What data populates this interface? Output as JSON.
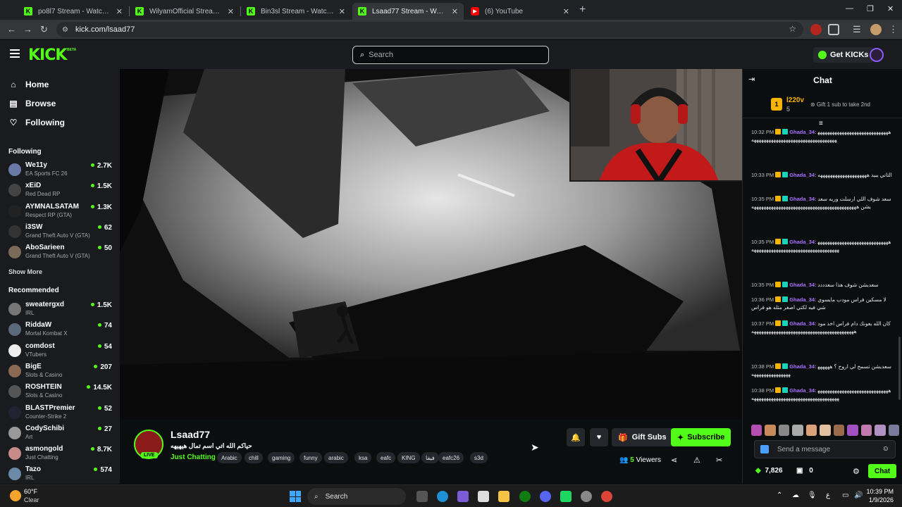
{
  "browser": {
    "tabs": [
      {
        "label": "po8l7 Stream - Watch Live on K",
        "icon": "kick",
        "active": false
      },
      {
        "label": "WilyamOfficial Stream - Watch",
        "icon": "kick",
        "active": false
      },
      {
        "label": "Bin3sl Stream - Watch Live on",
        "icon": "kick",
        "active": false
      },
      {
        "label": "Lsaad77 Stream - Watch Live o",
        "icon": "kick",
        "active": true
      },
      {
        "label": "(6) YouTube",
        "icon": "youtube",
        "active": false
      }
    ],
    "url": "kick.com/lsaad77",
    "extension_badge": "16"
  },
  "header": {
    "logo": "KICK",
    "logo_badge": "BETA",
    "search_placeholder": "Search",
    "get_kicks": "Get KICKs"
  },
  "sidebar": {
    "nav": [
      {
        "label": "Home",
        "icon": "home-icon"
      },
      {
        "label": "Browse",
        "icon": "browse-icon"
      },
      {
        "label": "Following",
        "icon": "heart-icon"
      }
    ],
    "following_heading": "Following",
    "following": [
      {
        "name": "We11y",
        "category": "EA Sports FC 26",
        "viewers": "2.7K",
        "color": "#6a7aa8"
      },
      {
        "name": "xEiD",
        "category": "Red Dead RP",
        "viewers": "1.5K",
        "color": "#444"
      },
      {
        "name": "AYMNALSATAM",
        "category": "Respect RP (GTA)",
        "viewers": "1.3K",
        "color": "#222"
      },
      {
        "name": "i3SW",
        "category": "Grand Theft Auto V (GTA)",
        "viewers": "62",
        "color": "#333"
      },
      {
        "name": "AboSarieen",
        "category": "Grand Theft Auto V (GTA)",
        "viewers": "50",
        "color": "#7a6a5a"
      }
    ],
    "show_more": "Show More",
    "recommended_heading": "Recommended",
    "recommended": [
      {
        "name": "sweatergxd",
        "category": "IRL",
        "viewers": "1.5K",
        "color": "#777"
      },
      {
        "name": "RiddaW",
        "category": "Mortal Kombat X",
        "viewers": "74",
        "color": "#5a6a7a"
      },
      {
        "name": "comdost",
        "category": "VTubers",
        "viewers": "54",
        "color": "#eee"
      },
      {
        "name": "BigE",
        "category": "Slots & Casino",
        "viewers": "207",
        "color": "#8a6a55"
      },
      {
        "name": "ROSHTEIN",
        "category": "Slots & Casino",
        "viewers": "14.5K",
        "color": "#555"
      },
      {
        "name": "BLASTPremier",
        "category": "Counter-Strike 2",
        "viewers": "52",
        "color": "#223"
      },
      {
        "name": "CodySchibi",
        "category": "Art",
        "viewers": "27",
        "color": "#999"
      },
      {
        "name": "asmongold",
        "category": "Just Chatting",
        "viewers": "8.7K",
        "color": "#c98a8a"
      },
      {
        "name": "Tazo",
        "category": "IRL",
        "viewers": "574",
        "color": "#6a8aa8"
      }
    ]
  },
  "stream": {
    "live_badge": "LIVE",
    "streamer": "Lsaad77",
    "title": "حياكم الله اتي اسم تمال هيهيهه",
    "category": "Just Chatting",
    "tags": [
      "Arabic",
      "chill",
      "gaming",
      "funny",
      "arabic",
      "ksa",
      "eafc",
      "KING",
      "فيفا",
      "eafc26",
      "s3d"
    ],
    "gift_subs": "Gift Subs",
    "subscribe": "Subscribe",
    "viewer_count": "5",
    "viewer_label": "Viewers"
  },
  "chat": {
    "title": "Chat",
    "leaderboard": {
      "rank": "1",
      "user": "l220v",
      "count": "5",
      "cta": "Gift 1 sub to take 2nd"
    },
    "messages": [
      {
        "time": "10:32 PM",
        "user": "Ghada_34",
        "text": "ههههههههههههههههههههههههههههههههههههههههههههههههههههههههههههههههه"
      },
      {
        "time": "10:33 PM",
        "user": "Ghada_34",
        "text": "الثاني يبيد ههههههههههههههههههههه"
      },
      {
        "time": "10:35 PM",
        "user": "Ghada_34",
        "text": "سعد شوف اللي ارسلت وريه سعديشن هههههههههههههههههههههههههههههههههههههههههههه"
      },
      {
        "time": "10:35 PM",
        "user": "Ghada_34",
        "text": "هههههههههههههههههههههههههههههههههههههههههههههههههههههههههههههههههه"
      },
      {
        "time": "10:35 PM",
        "user": "Ghada_34",
        "text": "سعديشن شوف هذا سعدددد"
      },
      {
        "time": "10:36 PM",
        "user": "Ghada_34",
        "text": "لا مسكين فراس مودب مايسوي شي فيه لكتي اصغر مثله هو فراس"
      },
      {
        "time": "10:37 PM",
        "user": "Ghada_34",
        "text": "كان الله بعونك دام فراس اخذ مود ههههههههههههههههههههههههههههههههههههههههههه"
      },
      {
        "time": "10:38 PM",
        "user": "Ghada_34",
        "text": "سعديشن تسمح لي اروح ؟ هههههههههههههههههههههه"
      },
      {
        "time": "10:38 PM",
        "user": "Ghada_34",
        "text": "هههههههههههههههههههههههههههههههههههههههههههههههههههههههههههههههههه"
      }
    ],
    "input_placeholder": "Send a message",
    "kicks_count": "7,826",
    "gift_count": "0",
    "send_label": "Chat"
  },
  "taskbar": {
    "temperature": "60°F",
    "weather": "Clear",
    "search_label": "Search",
    "time": "10:39 PM",
    "date": "1/9/2026",
    "lang": "ع"
  }
}
